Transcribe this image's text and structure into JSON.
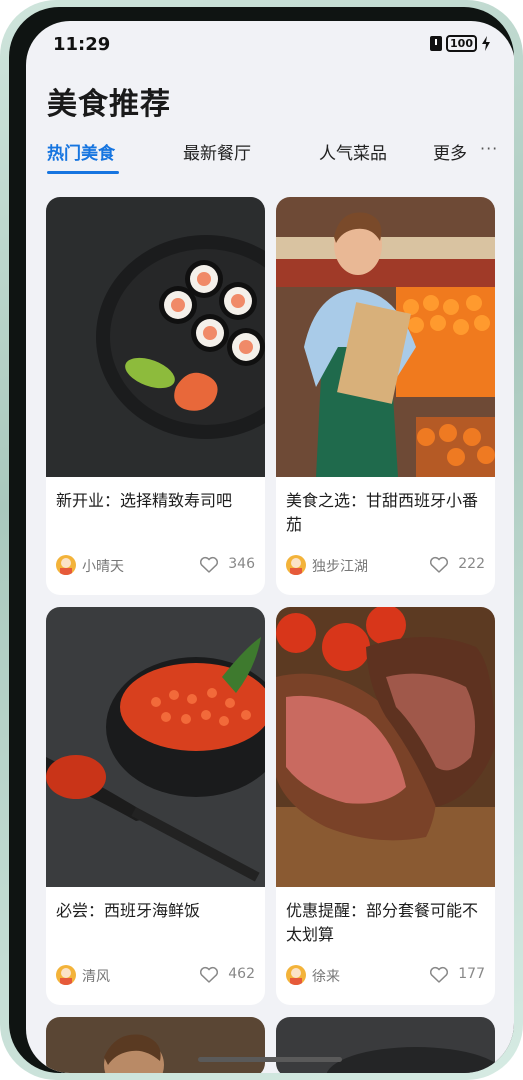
{
  "status": {
    "time": "11:29",
    "battery": "100"
  },
  "page": {
    "title": "美食推荐"
  },
  "tabs": [
    {
      "label": "热门美食",
      "active": true
    },
    {
      "label": "最新餐厅",
      "active": false
    },
    {
      "label": "人气菜品",
      "active": false
    },
    {
      "label": "更多",
      "active": false
    }
  ],
  "more_icon": "ellipsis-icon",
  "cards": [
    {
      "title": "新开业：选择精致寿司吧",
      "author": "小晴天",
      "likes": "346",
      "image": "sushi-plate"
    },
    {
      "title": "美食之选：甘甜西班牙小番茄",
      "author": "独步江湖",
      "likes": "222",
      "image": "grocer-with-clipboard"
    },
    {
      "title": "必尝：西班牙海鲜饭",
      "author": "清风",
      "likes": "462",
      "image": "salmon-roe-bowl"
    },
    {
      "title": "优惠提醒：部分套餐可能不太划算",
      "author": "徐来",
      "likes": "177",
      "image": "grilled-steak-tomatoes"
    }
  ],
  "colors": {
    "accent": "#1675e0",
    "background": "#f1f2f6"
  }
}
